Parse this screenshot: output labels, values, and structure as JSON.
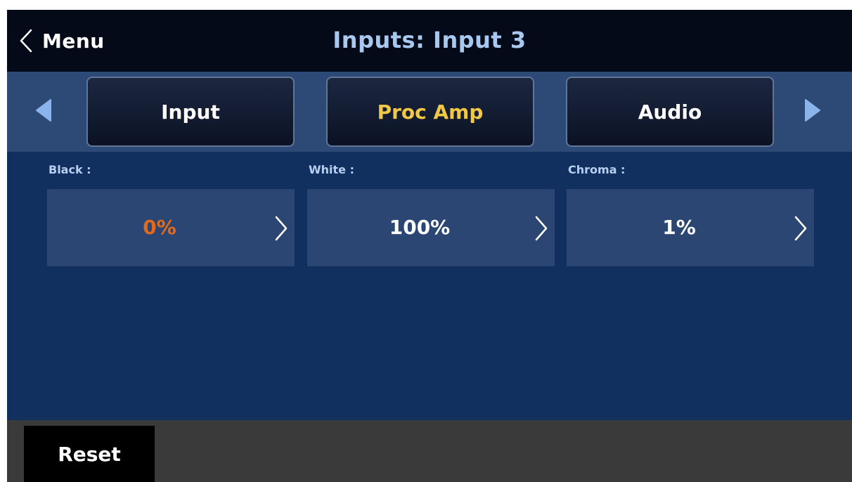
{
  "header": {
    "back_label": "Menu",
    "title": "Inputs: Input 3"
  },
  "tabs": [
    {
      "label": "Input",
      "active": false
    },
    {
      "label": "Proc Amp",
      "active": true
    },
    {
      "label": "Audio",
      "active": false
    }
  ],
  "fields": [
    {
      "label": "Black :",
      "value": "0%",
      "highlighted": true
    },
    {
      "label": "White :",
      "value": "100%",
      "highlighted": false
    },
    {
      "label": "Chroma :",
      "value": "1%",
      "highlighted": false
    }
  ],
  "footer": {
    "reset_label": "Reset"
  },
  "colors": {
    "header_bg": "#050a18",
    "tab_bar_bg": "#2d4a76",
    "content_bg": "#12305f",
    "field_bg": "#2b4672",
    "title_text": "#a8c8f0",
    "active_tab_text": "#f0c848",
    "highlight_value": "#e36a1a",
    "arrow_accent": "#8cb4ec",
    "footer_bg": "#3a3a3a"
  },
  "icons": {
    "back": "chevron-left-icon",
    "tab_prev": "triangle-left-icon",
    "tab_next": "triangle-right-icon",
    "field_open": "chevron-right-icon"
  }
}
